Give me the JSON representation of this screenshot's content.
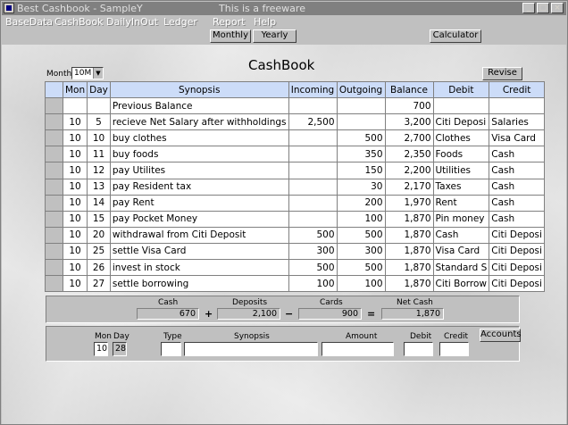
{
  "window": {
    "title": "Best Cashbook - SampleY",
    "subtitle": "This is a freeware",
    "buttons": {
      "minimize": "_",
      "maximize": "□",
      "close": "×"
    }
  },
  "menu": [
    "BaseData",
    "CashBook",
    "DailyInOut",
    "Ledger",
    "Report",
    "Help"
  ],
  "toolbar": {
    "monthly": "Monthly",
    "yearly": "Yearly",
    "calculator": "Calculator"
  },
  "heading": "CashBook",
  "month": {
    "label": "Month",
    "value": "10M"
  },
  "revise_label": "Revise",
  "columns": [
    "Mon",
    "Day",
    "Synopsis",
    "Incoming",
    "Outgoing",
    "Balance",
    "Debit",
    "Credit"
  ],
  "rows": [
    [
      "",
      "",
      "Previous Balance",
      "",
      "",
      "700",
      "",
      ""
    ],
    [
      "10",
      "5",
      "recieve Net Salary after withholdings",
      "2,500",
      "",
      "3,200",
      "Citi Deposi",
      "Salaries"
    ],
    [
      "10",
      "10",
      "buy clothes",
      "",
      "500",
      "2,700",
      "Clothes",
      "Visa Card"
    ],
    [
      "10",
      "11",
      "buy foods",
      "",
      "350",
      "2,350",
      "Foods",
      "Cash"
    ],
    [
      "10",
      "12",
      "pay Utilites",
      "",
      "150",
      "2,200",
      "Utilities",
      "Cash"
    ],
    [
      "10",
      "13",
      "pay Resident tax",
      "",
      "30",
      "2,170",
      "Taxes",
      "Cash"
    ],
    [
      "10",
      "14",
      "pay Rent",
      "",
      "200",
      "1,970",
      "Rent",
      "Cash"
    ],
    [
      "10",
      "15",
      "pay Pocket Money",
      "",
      "100",
      "1,870",
      "Pin money",
      "Cash"
    ],
    [
      "10",
      "20",
      "withdrawal from Citi Deposit",
      "500",
      "500",
      "1,870",
      "Cash",
      "Citi Deposi"
    ],
    [
      "10",
      "25",
      "settle Visa Card",
      "300",
      "300",
      "1,870",
      "Visa Card",
      "Citi Deposi"
    ],
    [
      "10",
      "26",
      "invest in stock",
      "500",
      "500",
      "1,870",
      "Standard S",
      "Citi Deposi"
    ],
    [
      "10",
      "27",
      "settle borrowing",
      "100",
      "100",
      "1,870",
      "Citi Borrow",
      "Citi Deposi"
    ]
  ],
  "summary": {
    "cash_label": "Cash",
    "cash": "670",
    "plus": "+",
    "deposits_label": "Deposits",
    "deposits": "2,100",
    "minus": "−",
    "cards_label": "Cards",
    "cards": "900",
    "equals": "=",
    "netcash_label": "Net Cash",
    "netcash": "1,870"
  },
  "entry": {
    "mon_label": "Mon",
    "mon": "10",
    "day_label": "Day",
    "day": "28",
    "type_label": "Type",
    "synopsis_label": "Synopsis",
    "amount_label": "Amount",
    "debit_label": "Debit",
    "credit_label": "Credit",
    "accounts_label": "Accounts"
  }
}
